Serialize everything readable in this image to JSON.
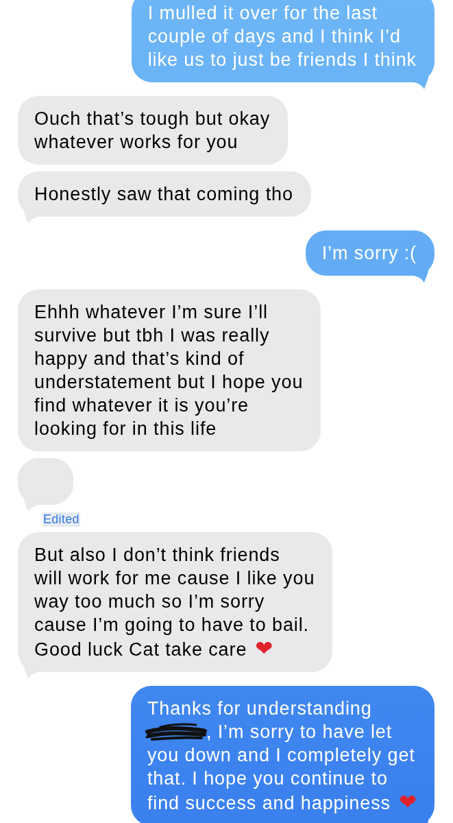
{
  "messages": [
    {
      "kind": "sent",
      "text": "I mulled it over for the last\ncouple of days and I think I’d\nlike us to just be friends I think",
      "tail": true
    },
    {
      "kind": "received",
      "text": "Ouch that’s tough but okay\nwhatever works for you",
      "tail": false
    },
    {
      "kind": "received",
      "text": "Honestly saw that coming tho",
      "tail": true
    },
    {
      "kind": "sent",
      "text": "I’m sorry :(",
      "tail": true
    },
    {
      "kind": "received",
      "text": "Ehhh whatever I’m sure I’ll\nsurvive but tbh I was really\nhappy and that’s kind of\nunderstatement but I hope you\nfind whatever it is you’re\nlooking for in this life",
      "tail": false
    },
    {
      "kind": "received",
      "tail": true,
      "status": "Edited"
    },
    {
      "kind": "received",
      "text": "But also I don’t think friends\nwill work for me cause I like you\nway too much so I’m sorry\ncause I’m going to have to bail.\nGood luck Cat take care",
      "emoji": "❤",
      "tail": true
    },
    {
      "kind": "sent",
      "text": "Thanks for understanding\n",
      "redacted": true,
      "text_after": ", I’m sorry to have let\nyou down and I completely get\nthat. I hope you continue to\nfind success and happiness",
      "emoji": "❤",
      "tail": true
    }
  ]
}
